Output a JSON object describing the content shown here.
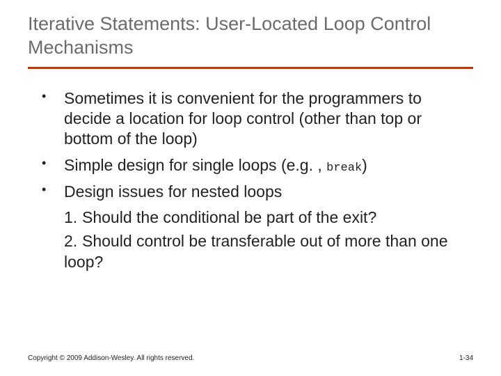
{
  "title": "Iterative Statements: User-Located Loop Control Mechanisms",
  "bullets": [
    {
      "text": "Sometimes it is convenient for the programmers to decide a location for loop control (other than top or bottom of the loop)"
    },
    {
      "prefix": "Simple design for single loops (e.g. , ",
      "code": "break",
      "suffix": ")"
    },
    {
      "text": "Design issues for nested loops"
    }
  ],
  "sub": [
    {
      "n": "1.",
      "text": "Should the conditional be part of the exit?"
    },
    {
      "n": "2.",
      "text": "Should control be transferable out of more than one loop?"
    }
  ],
  "footer": {
    "copyright": "Copyright © 2009 Addison-Wesley. All rights reserved.",
    "page": "1-34"
  }
}
